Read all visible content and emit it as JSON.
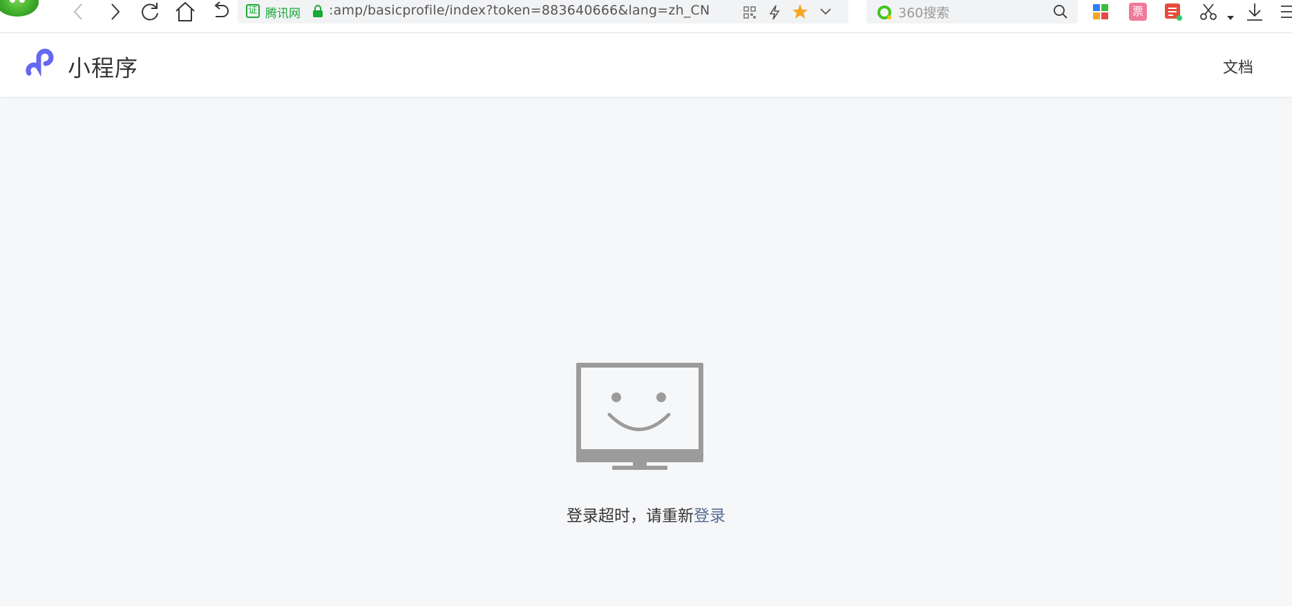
{
  "browser": {
    "address_bar": {
      "cert_icon_text": "证",
      "cert_label": "腾讯网",
      "url": ":amp/basicprofile/index?token=883640666&lang=zh_CN"
    },
    "search": {
      "placeholder": "360搜索"
    },
    "toolbar": {
      "ticket_label": "票"
    }
  },
  "app": {
    "title": "小程序",
    "nav_docs": "文档",
    "brand_color": "#6467f0",
    "link_color": "#576b95"
  },
  "message": {
    "text": "登录超时，请重新",
    "link": "登录"
  }
}
